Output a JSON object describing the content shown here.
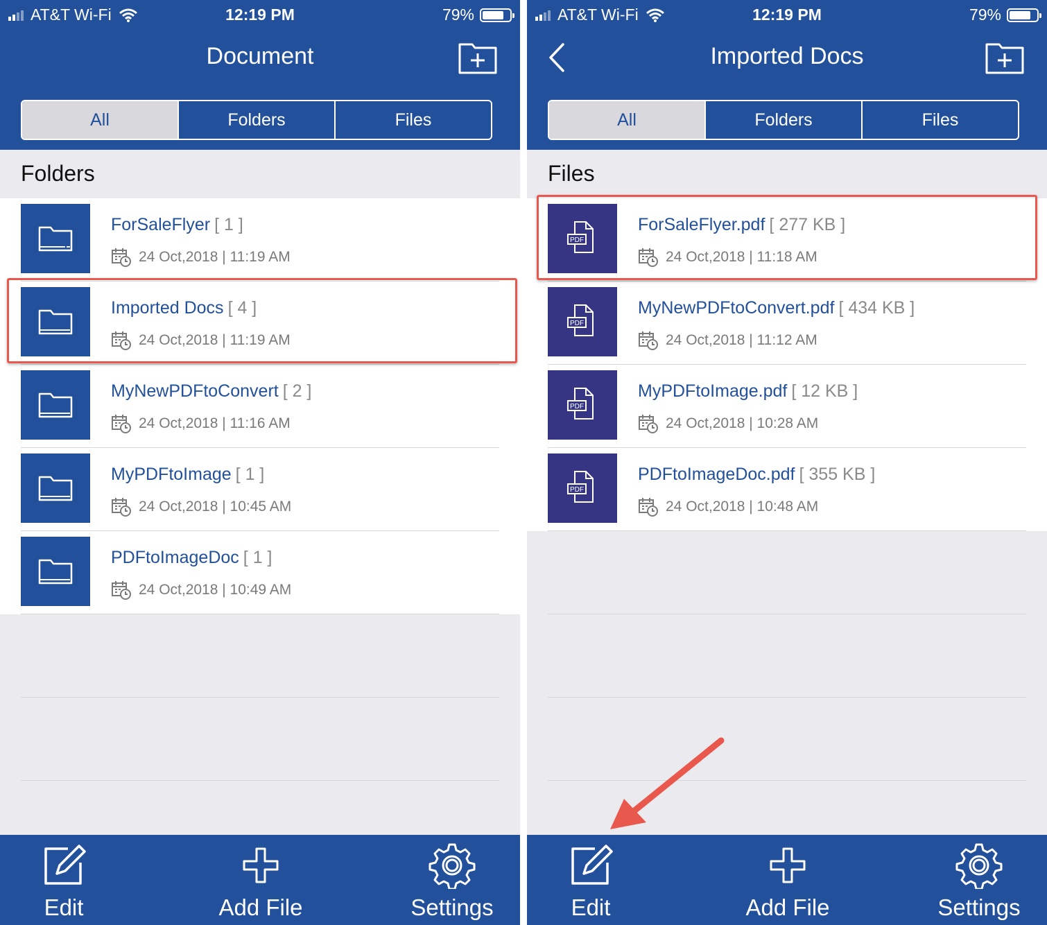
{
  "colors": {
    "brand": "#22509a",
    "pdf_tile": "#353584",
    "highlight": "#e8584d",
    "meta": "#8a8a8a"
  },
  "left": {
    "status": {
      "carrier": "AT&T Wi-Fi",
      "time": "12:19 PM",
      "battery": "79%",
      "battery_fraction": 0.79
    },
    "nav": {
      "title": "Document",
      "action_icon": "new-folder-icon"
    },
    "segments": [
      "All",
      "Folders",
      "Files"
    ],
    "segment_selected": "All",
    "section": "Folders",
    "items": [
      {
        "name": "ForSaleFlyer",
        "meta": "[ 1 ]",
        "date": "24 Oct,2018 | 11:19 AM"
      },
      {
        "name": "Imported Docs",
        "meta": "[ 4 ]",
        "date": "24 Oct,2018 | 11:19 AM"
      },
      {
        "name": "MyNewPDFtoConvert",
        "meta": "[ 2 ]",
        "date": "24 Oct,2018 | 11:16 AM"
      },
      {
        "name": "MyPDFtoImage",
        "meta": "[ 1 ]",
        "date": "24 Oct,2018 | 10:45 AM"
      },
      {
        "name": "PDFtoImageDoc",
        "meta": "[ 1 ]",
        "date": "24 Oct,2018 | 10:49 AM"
      }
    ],
    "tabs": [
      {
        "label": "Edit",
        "icon": "edit-icon"
      },
      {
        "label": "Add File",
        "icon": "plus-icon"
      },
      {
        "label": "Settings",
        "icon": "gear-icon"
      }
    ]
  },
  "right": {
    "status": {
      "carrier": "AT&T Wi-Fi",
      "time": "12:19 PM",
      "battery": "79%",
      "battery_fraction": 0.79
    },
    "nav": {
      "title": "Imported Docs",
      "back_icon": "chevron-left-icon",
      "action_icon": "new-folder-icon"
    },
    "segments": [
      "All",
      "Folders",
      "Files"
    ],
    "segment_selected": "All",
    "section": "Files",
    "items": [
      {
        "name": "ForSaleFlyer.pdf",
        "meta": "[ 277 KB ]",
        "date": "24 Oct,2018 | 11:18 AM",
        "badge": "PDF"
      },
      {
        "name": "MyNewPDFtoConvert.pdf",
        "meta": "[ 434 KB ]",
        "date": "24 Oct,2018 | 11:12 AM",
        "badge": "PDF"
      },
      {
        "name": "MyPDFtoImage.pdf",
        "meta": "[ 12 KB ]",
        "date": "24 Oct,2018 | 10:28 AM",
        "badge": "PDF"
      },
      {
        "name": "PDFtoImageDoc.pdf",
        "meta": "[ 355 KB ]",
        "date": "24 Oct,2018 | 10:48 AM",
        "badge": "PDF"
      }
    ],
    "tabs": [
      {
        "label": "Edit",
        "icon": "edit-icon"
      },
      {
        "label": "Add File",
        "icon": "plus-icon"
      },
      {
        "label": "Settings",
        "icon": "gear-icon"
      }
    ]
  }
}
